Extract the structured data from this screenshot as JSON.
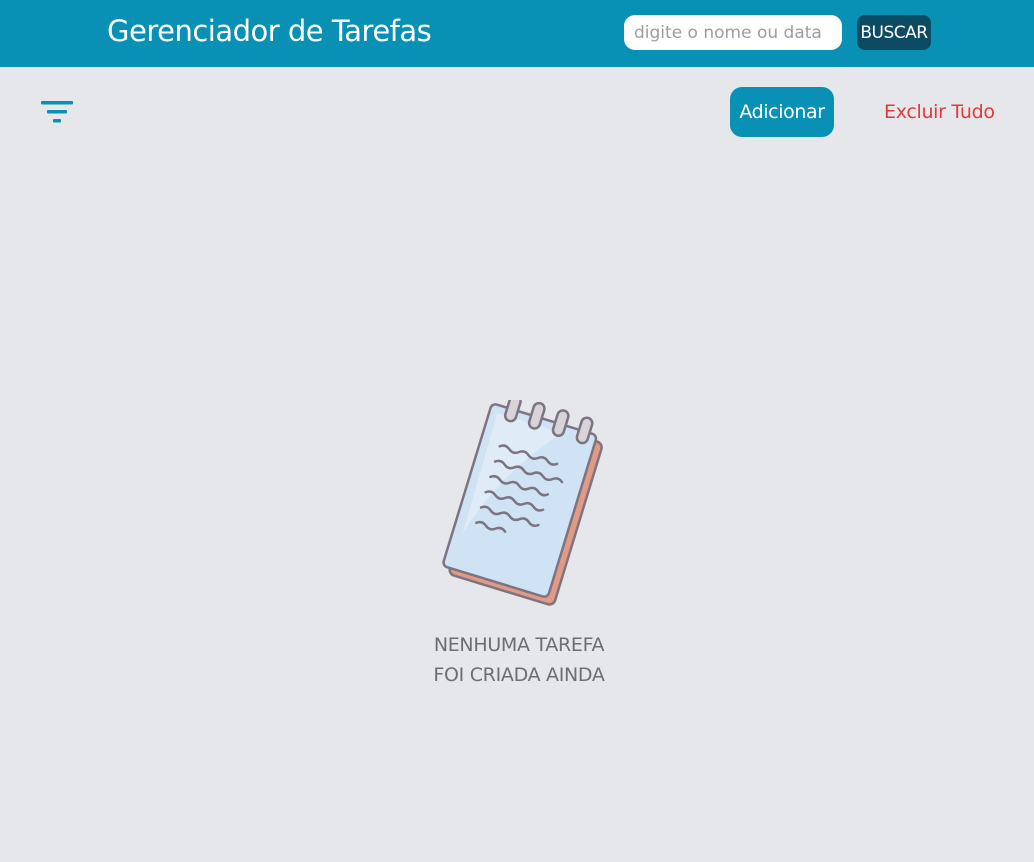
{
  "header": {
    "title": "Gerenciador de Tarefas",
    "search_placeholder": "digite o nome ou data",
    "search_value": "",
    "search_button_label": "BUSCAR"
  },
  "toolbar": {
    "filter_icon": "filter-icon",
    "add_label": "Adicionar",
    "delete_all_label": "Excluir Tudo"
  },
  "empty_state": {
    "illustration": "notepad-icon",
    "line1": "NENHUMA TAREFA",
    "line2": "FOI CRIADA AINDA"
  },
  "colors": {
    "header_bg": "#0891b5",
    "page_bg": "#e6e7eb",
    "search_button_bg": "#0d4a63",
    "delete_text": "#e23a3a"
  }
}
